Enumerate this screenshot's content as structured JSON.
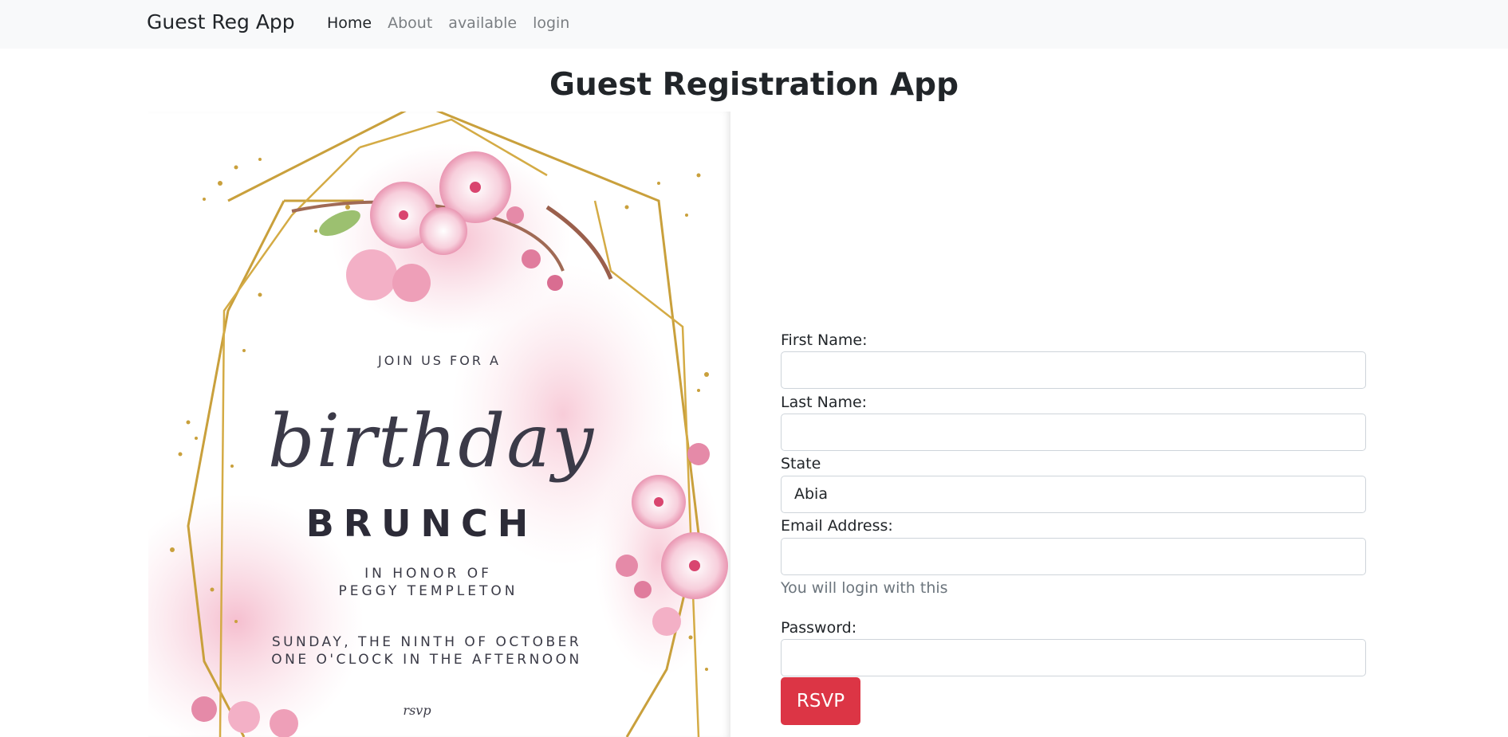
{
  "navbar": {
    "brand": "Guest Reg App",
    "links": [
      "Home",
      "About",
      "available",
      "login"
    ]
  },
  "page": {
    "title": "Guest Registration App"
  },
  "invitation": {
    "line1": "JOIN US FOR A",
    "line2": "birthday",
    "line3": "BRUNCH",
    "line4": "IN HONOR OF",
    "line5": "PEGGY TEMPLETON",
    "line6": "SUNDAY, THE NINTH OF OCTOBER",
    "line7": "ONE O'CLOCK IN THE AFTERNOON",
    "line8": "rsvp"
  },
  "form": {
    "first_name_label": "First Name:",
    "first_name_value": "",
    "last_name_label": "Last Name:",
    "last_name_value": "",
    "state_label": "State",
    "state_value": "Abia",
    "email_label": "Email Address:",
    "email_value": "",
    "email_help": "You will login with this",
    "password_label": "Password:",
    "password_value": "",
    "submit_label": "RSVP"
  },
  "colors": {
    "navbar_bg": "#f8f9fa",
    "button_bg": "#dc3545",
    "muted_text": "#6c757d",
    "gold": "#c9a03c",
    "blush": "#f4c6d4"
  }
}
